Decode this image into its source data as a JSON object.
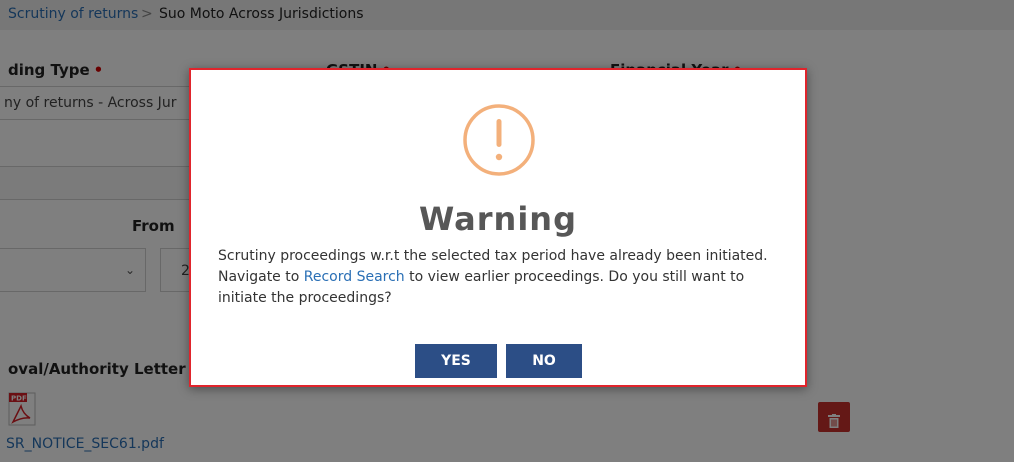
{
  "breadcrumb": {
    "parent": "Scrutiny of returns",
    "separator": ">",
    "current": "Suo Moto Across Jurisdictions"
  },
  "form": {
    "proceeding_type_label": "ding Type",
    "proceeding_type_value": "ny of returns - Across Jur",
    "gstin_label": "GSTIN",
    "financial_year_label": "Financial Year",
    "required_mark": "•",
    "from_label": "From",
    "from_value_partial": "2",
    "approval_label": "oval/Authority Letter",
    "pdf_file": "SR_NOTICE_SEC61.pdf",
    "pdf_icon_text": "PDF"
  },
  "modal": {
    "title": "Warning",
    "message_part1": "Scrutiny proceedings w.r.t the selected tax period have already been initiated. Navigate to ",
    "message_link": "Record Search",
    "message_part2": " to view earlier proceedings. Do you still want to initiate the proceedings?",
    "yes_label": "YES",
    "no_label": "NO"
  },
  "colors": {
    "warning_icon": "#f3b07b",
    "modal_border": "#e0242c",
    "button": "#2c4e86",
    "delete": "#c9302c",
    "link": "#2a6fb5"
  }
}
